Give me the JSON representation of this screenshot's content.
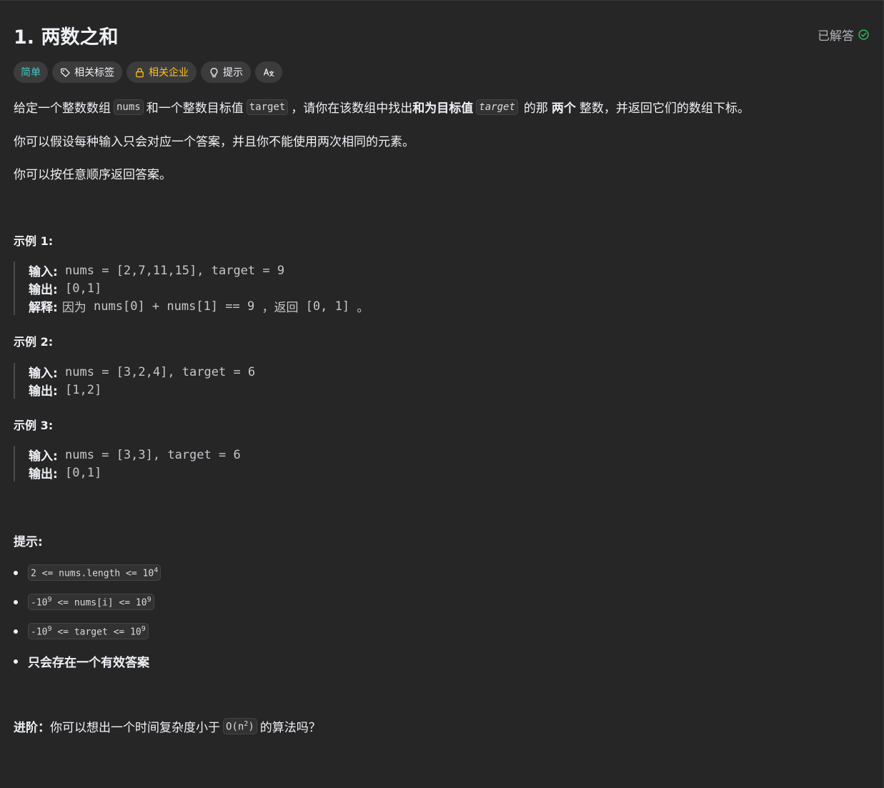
{
  "problem": {
    "title": "1. 两数之和",
    "status": "已解答"
  },
  "tags": {
    "difficulty": "简单",
    "topics": "相关标签",
    "companies": "相关企业",
    "hints": "提示"
  },
  "description": {
    "p1_a": "给定一个整数数组",
    "p1_code1": "nums",
    "p1_b": "和一个整数目标值",
    "p1_code2": "target",
    "p1_c": "，请你在该数组中找出",
    "p1_bold1": "和为目标值",
    "p1_code3": "target",
    "p1_d": "的那",
    "p1_bold2": "两个",
    "p1_e": "整数，并返回它们的数组下标。",
    "p2": "你可以假设每种输入只会对应一个答案，并且你不能使用两次相同的元素。",
    "p3": "你可以按任意顺序返回答案。"
  },
  "examples": [
    {
      "title": "示例 1:",
      "input_label": "输入:",
      "input": " nums = [2,7,11,15], target = 9",
      "output_label": "输出:",
      "output": " [0,1]",
      "explain_label": "解释:",
      "explain_a": "因为",
      "explain_b": " nums[0] + nums[1] == 9 ",
      "explain_c": "，返回",
      "explain_d": " [0, 1] ",
      "explain_e": "。"
    },
    {
      "title": "示例 2:",
      "input_label": "输入:",
      "input": " nums = [3,2,4], target = 6",
      "output_label": "输出:",
      "output": " [1,2]"
    },
    {
      "title": "示例 3:",
      "input_label": "输入:",
      "input": " nums = [3,3], target = 6",
      "output_label": "输出:",
      "output": " [0,1]"
    }
  ],
  "constraints": {
    "title": "提示:",
    "c1_text": "2 <= nums.length <= 10",
    "c1_sup": "4",
    "c2_a": "-10",
    "c2_sup1": "9",
    "c2_b": " <= nums[i] <= 10",
    "c2_sup2": "9",
    "c3_a": "-10",
    "c3_sup1": "9",
    "c3_b": " <= target <= 10",
    "c3_sup2": "9",
    "c4": "只会存在一个有效答案"
  },
  "followup": {
    "label": "进阶：",
    "text_a": "你可以想出一个时间复杂度小于",
    "code": "O(n",
    "code_sup": "2",
    "code_end": ")",
    "text_b": "的算法吗？"
  },
  "colors": {
    "easy": "#46c6c2",
    "company": "#ffc01e",
    "solved_check": "#2cbb5d",
    "background": "#262626"
  }
}
